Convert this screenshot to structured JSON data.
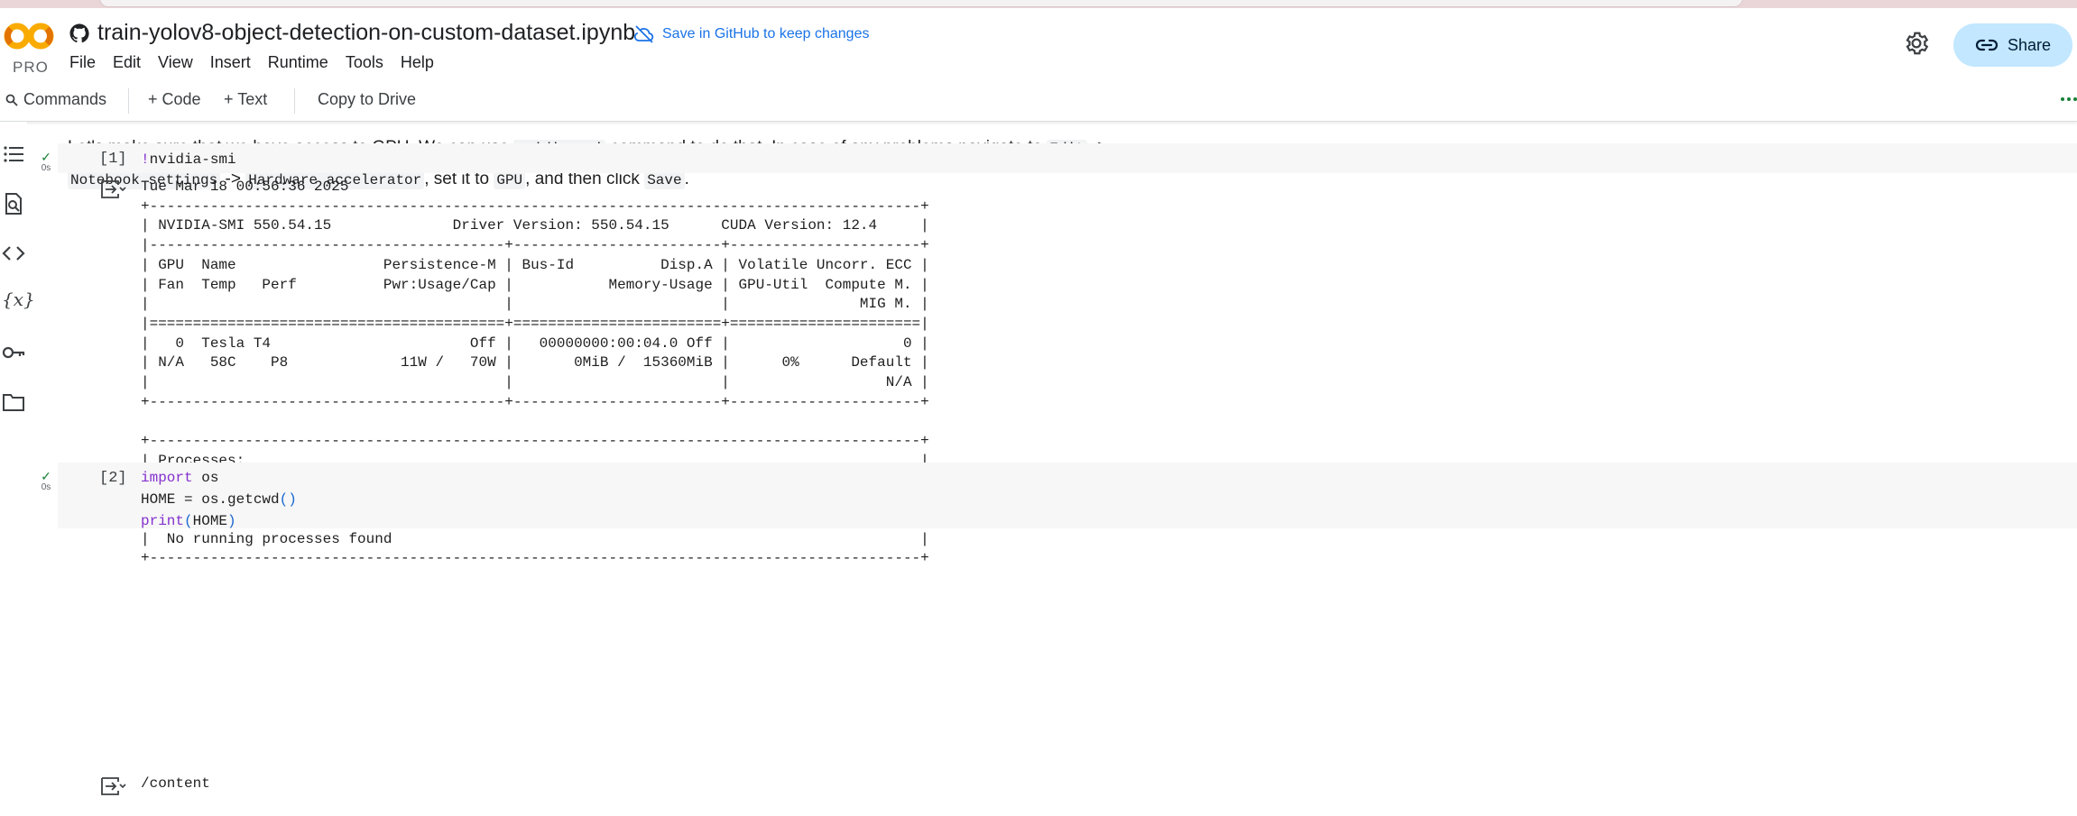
{
  "header": {
    "logo_badge": "PRO",
    "notebook_title": "train-yolov8-object-detection-on-custom-dataset.ipynb",
    "save_link": "Save in GitHub to keep changes",
    "share_label": "Share",
    "menu": [
      "File",
      "Edit",
      "View",
      "Insert",
      "Runtime",
      "Tools",
      "Help"
    ]
  },
  "toolbar": {
    "commands": "Commands",
    "add_code": "+ Code",
    "add_text": "+ Text",
    "copy_to_drive": "Copy to Drive"
  },
  "text_cell": {
    "p1": "Let's make sure that we have access to GPU. We can use ",
    "c1": "nvidia-smi",
    "p2": " command to do that. In case of any problems navigate to ",
    "c2": "Edit",
    "p3": " ->",
    "c3": "Notebook settings",
    "p4": " -> ",
    "c4": "Hardware accelerator",
    "p5": ", set it to ",
    "c5": "GPU",
    "p6": ", and then click ",
    "c6": "Save",
    "p7": "."
  },
  "cells": [
    {
      "number": "[1]",
      "status_time": "0s",
      "code_bang": "!",
      "code_rest": "nvidia-smi",
      "output": "Tue Mar 18 00:56:36 2025       \n+-----------------------------------------------------------------------------------------+\n| NVIDIA-SMI 550.54.15              Driver Version: 550.54.15      CUDA Version: 12.4     |\n|-----------------------------------------+------------------------+----------------------+\n| GPU  Name                 Persistence-M | Bus-Id          Disp.A | Volatile Uncorr. ECC |\n| Fan  Temp   Perf          Pwr:Usage/Cap |           Memory-Usage | GPU-Util  Compute M. |\n|                                         |                        |               MIG M. |\n|=========================================+========================+======================|\n|   0  Tesla T4                       Off |   00000000:00:04.0 Off |                    0 |\n| N/A   58C    P8             11W /   70W |       0MiB /  15360MiB |      0%      Default |\n|                                         |                        |                  N/A |\n+-----------------------------------------+------------------------+----------------------+\n                                                                                         \n+-----------------------------------------------------------------------------------------+\n| Processes:                                                                              |\n|  GPU   GI   CI        PID   Type   Process name                              GPU Memory |\n|        ID   ID                                                               Usage      |\n|=========================================================================================|\n|  No running processes found                                                             |\n+-----------------------------------------------------------------------------------------+"
    },
    {
      "number": "[2]",
      "status_time": "0s",
      "line1_kw": "import",
      "line1_rest": " os",
      "line2_a": "HOME = os.getcwd",
      "line2_par": "()",
      "line3_fn": "print",
      "line3_open": "(",
      "line3_arg": "HOME",
      "line3_close": ")",
      "output": "/content"
    }
  ],
  "colors": {
    "accent": "#1a73e8",
    "share_bg": "#c2e7ff",
    "success": "#188038",
    "keyword": "#8430ce",
    "cell_bg": "#f7f7f7"
  }
}
